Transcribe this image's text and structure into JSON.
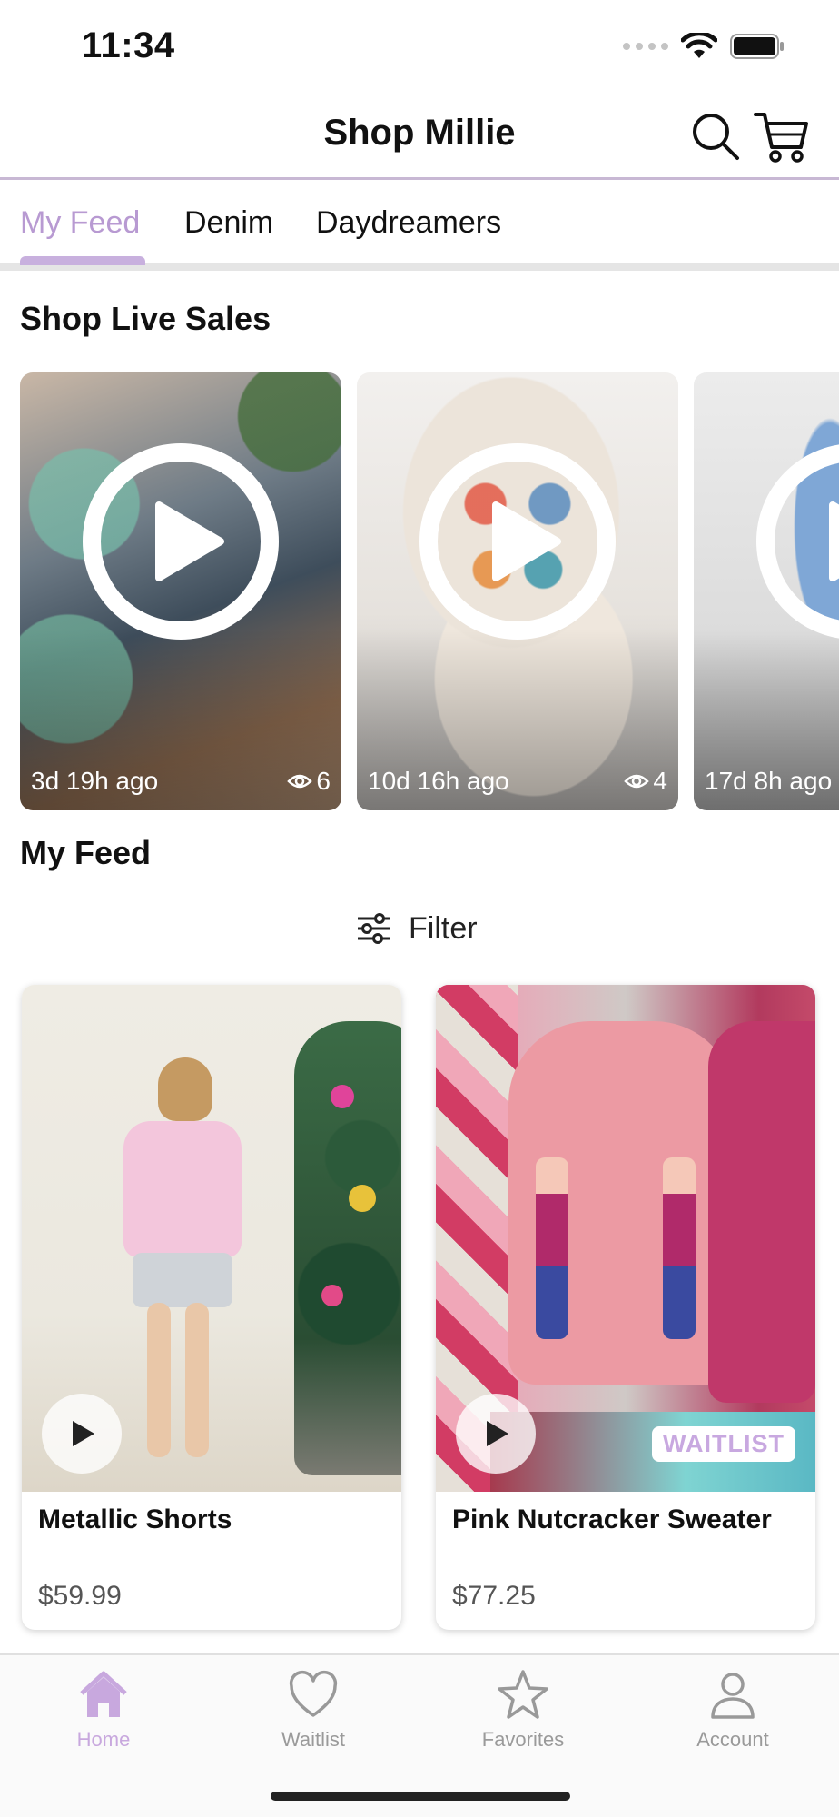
{
  "status_bar": {
    "time": "11:34"
  },
  "header": {
    "title": "Shop Millie",
    "search_icon": "search-icon",
    "cart_icon": "cart-icon"
  },
  "tabs": [
    {
      "label": "My Feed",
      "active": true
    },
    {
      "label": "Denim",
      "active": false
    },
    {
      "label": "Daydreamers",
      "active": false
    }
  ],
  "live_sales": {
    "title": "Shop Live Sales",
    "cards": [
      {
        "time_ago": "3d 19h ago",
        "views": "6"
      },
      {
        "time_ago": "10d 16h ago",
        "views": "4"
      },
      {
        "time_ago": "17d 8h ago",
        "views": ""
      }
    ]
  },
  "feed": {
    "title": "My Feed",
    "filter_label": "Filter",
    "products": [
      {
        "name": "Metallic Shorts",
        "price": "$59.99",
        "badge": ""
      },
      {
        "name": "Pink Nutcracker Sweater",
        "price": "$77.25",
        "badge": "WAITLIST"
      }
    ]
  },
  "bottom_nav": [
    {
      "label": "Home",
      "icon": "home-icon",
      "active": true
    },
    {
      "label": "Waitlist",
      "icon": "heart-icon",
      "active": false
    },
    {
      "label": "Favorites",
      "icon": "star-icon",
      "active": false
    },
    {
      "label": "Account",
      "icon": "person-icon",
      "active": false
    }
  ],
  "colors": {
    "accent": "#c8a8de",
    "divider": "#c8b8d4"
  }
}
